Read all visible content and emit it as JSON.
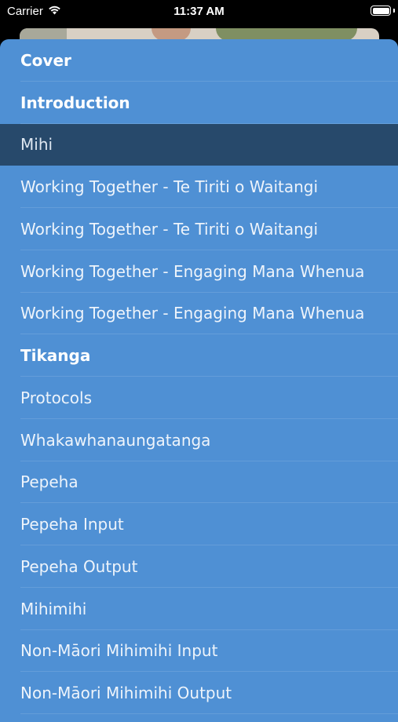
{
  "status_bar": {
    "carrier": "Carrier",
    "time": "11:37 AM",
    "wifi_icon": "wifi-icon",
    "battery_icon": "battery-icon",
    "battery_level": 1.0
  },
  "menu": {
    "background_color": "#4f90d4",
    "selected_color": "#27496b",
    "items": [
      {
        "label": "Cover",
        "type": "header"
      },
      {
        "label": "Introduction",
        "type": "header"
      },
      {
        "label": "Mihi",
        "type": "item",
        "selected": true
      },
      {
        "label": "Working Together - Te Tiriti o Waitangi",
        "type": "item"
      },
      {
        "label": "Working Together - Te Tiriti o Waitangi",
        "type": "item"
      },
      {
        "label": "Working Together - Engaging Mana Whenua",
        "type": "item"
      },
      {
        "label": "Working Together - Engaging Mana Whenua",
        "type": "item"
      },
      {
        "label": "Tikanga",
        "type": "header"
      },
      {
        "label": "Protocols",
        "type": "item"
      },
      {
        "label": "Whakawhanaungatanga",
        "type": "item"
      },
      {
        "label": "Pepeha",
        "type": "item"
      },
      {
        "label": "Pepeha Input",
        "type": "item"
      },
      {
        "label": "Pepeha Output",
        "type": "item"
      },
      {
        "label": "Mihimihi",
        "type": "item"
      },
      {
        "label": "Non-Māori Mihimihi Input",
        "type": "item"
      },
      {
        "label": "Non-Māori Mihimihi Output",
        "type": "item"
      }
    ]
  }
}
